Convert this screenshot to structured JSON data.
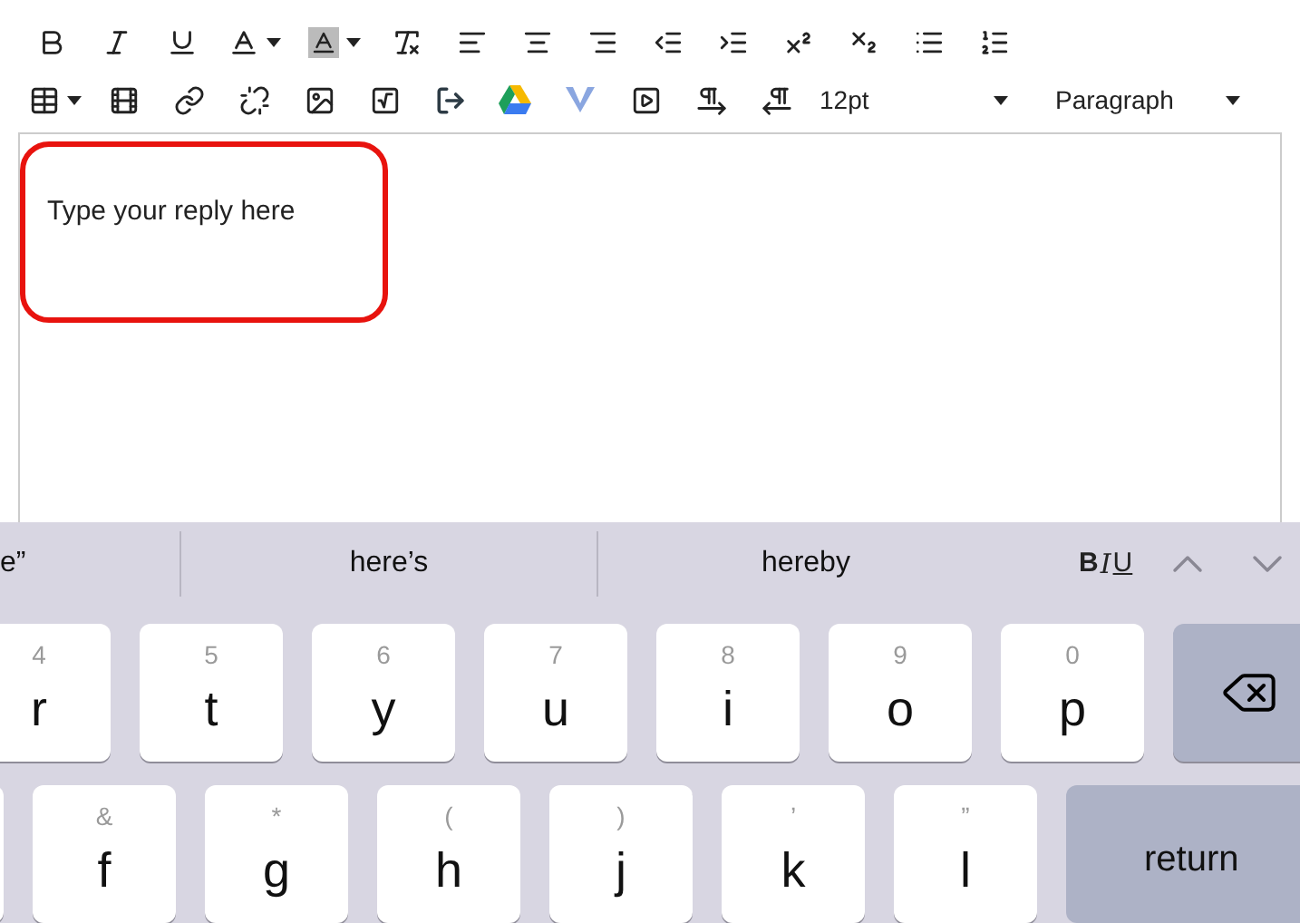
{
  "toolbar": {
    "font_size": "12pt",
    "block_format": "Paragraph"
  },
  "editor": {
    "placeholder": "Type your reply here",
    "highlighted": true
  },
  "keyboard": {
    "suggestions": [
      "e”",
      "here’s",
      "hereby"
    ],
    "format_buttons": [
      {
        "kind": "bold",
        "label": "B"
      },
      {
        "kind": "italic",
        "label": "I"
      },
      {
        "kind": "underline",
        "label": "U"
      }
    ],
    "rows": [
      [
        {
          "kind": "letter",
          "label": "r",
          "alt": "4"
        },
        {
          "kind": "letter",
          "label": "t",
          "alt": "5"
        },
        {
          "kind": "letter",
          "label": "y",
          "alt": "6"
        },
        {
          "kind": "letter",
          "label": "u",
          "alt": "7"
        },
        {
          "kind": "letter",
          "label": "i",
          "alt": "8"
        },
        {
          "kind": "letter",
          "label": "o",
          "alt": "9"
        },
        {
          "kind": "letter",
          "label": "p",
          "alt": "0"
        },
        {
          "kind": "delete"
        }
      ],
      [
        {
          "kind": "blank"
        },
        {
          "kind": "letter",
          "label": "f",
          "alt": "&"
        },
        {
          "kind": "letter",
          "label": "g",
          "alt": "*"
        },
        {
          "kind": "letter",
          "label": "h",
          "alt": "("
        },
        {
          "kind": "letter",
          "label": "j",
          "alt": ")"
        },
        {
          "kind": "letter",
          "label": "k",
          "alt": "’"
        },
        {
          "kind": "letter",
          "label": "l",
          "alt": "”"
        },
        {
          "kind": "return",
          "label": "return"
        }
      ]
    ]
  }
}
